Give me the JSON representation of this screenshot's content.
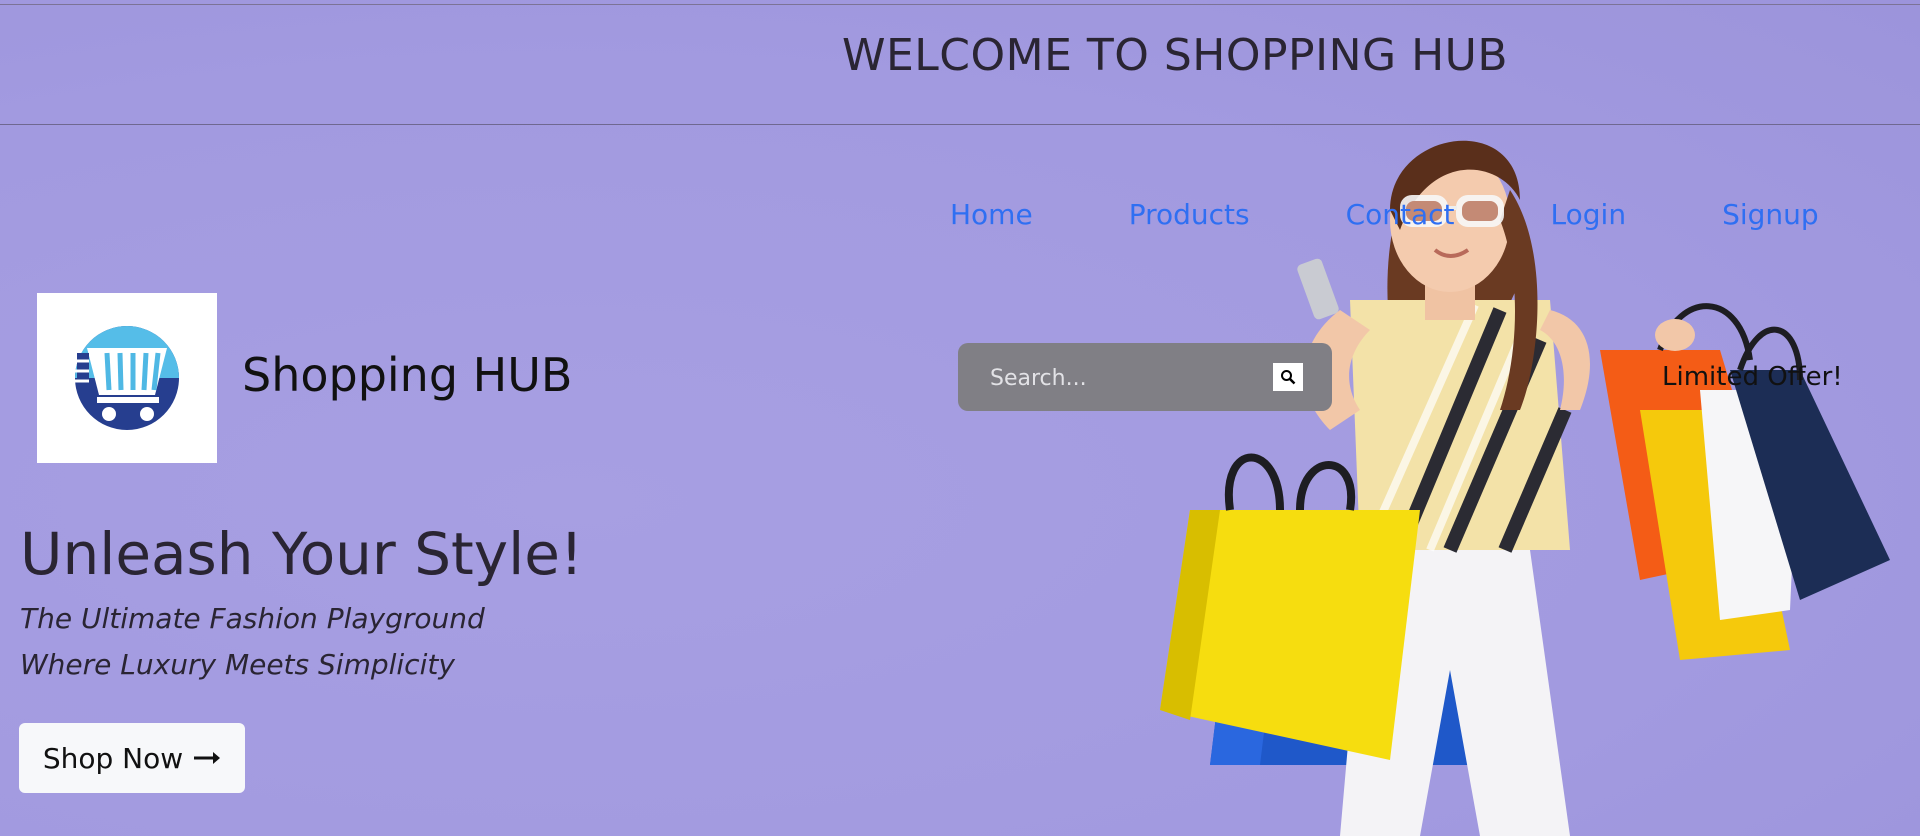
{
  "header": {
    "title": "WELCOME TO SHOPPING HUB"
  },
  "nav": {
    "items": [
      {
        "label": "Home"
      },
      {
        "label": "Products"
      },
      {
        "label": "Contact"
      },
      {
        "label": "Login"
      },
      {
        "label": "Signup"
      }
    ],
    "link_color": "#2f6ff2"
  },
  "brand": {
    "name": "Shopping HUB",
    "logo_icon": "shopping-cart-icon"
  },
  "search": {
    "placeholder": "Search...",
    "button_icon": "search-icon"
  },
  "promo": {
    "offer_text": "Limited Offer!"
  },
  "hero": {
    "headline": "Unleash Your Style!",
    "tagline_1": "The Ultimate Fashion Playground",
    "tagline_2": "Where Luxury Meets Simplicity",
    "cta_label": "Shop Now",
    "cta_icon": "arrow-right-icon"
  },
  "colors": {
    "background": "#a49ce0",
    "search_bg": "#807f85",
    "cta_bg": "#f7f8fa"
  }
}
